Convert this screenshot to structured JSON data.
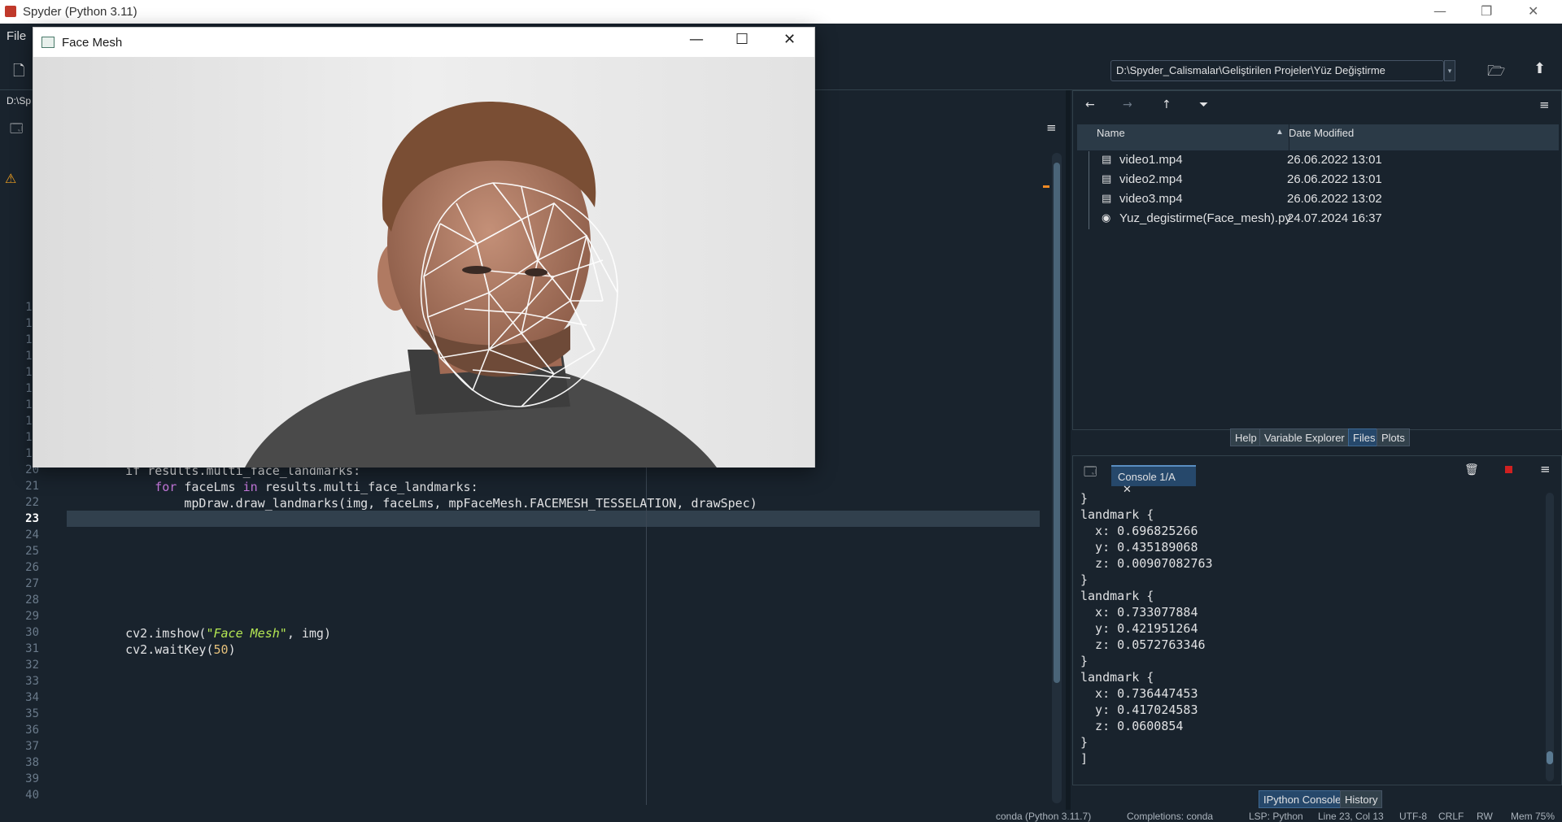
{
  "app": {
    "title": "Spyder (Python 3.11)",
    "window_controls": {
      "minimize": "—",
      "restore": "❐",
      "close": "✕"
    }
  },
  "menubar": {
    "items": [
      "File"
    ]
  },
  "toolbar": {
    "path": "D:\\Spyder_Calismalar\\Geliştirilen Projeler\\Yüz Değiştirme",
    "path_dropdown": "▾"
  },
  "editor": {
    "path_fragment": "D:\\Sp",
    "lines_visible": [
      "10",
      "11",
      "12",
      "13",
      "14",
      "15",
      "16",
      "17",
      "18",
      "19",
      "20",
      "21",
      "22",
      "23",
      "24",
      "25",
      "26",
      "27",
      "28",
      "29",
      "30",
      "31",
      "32",
      "33",
      "34",
      "35",
      "36",
      "37",
      "38",
      "39",
      "40"
    ],
    "current_line": "23",
    "code": {
      "l20": "    if results.multi_face_landmarks:",
      "l21_kw": "for",
      "l21_a": "        ",
      "l21_b": " faceLms ",
      "l21_kw2": "in",
      "l21_c": " results.multi_face_landmarks:",
      "l22": "            mpDraw.draw_landmarks(img, faceLms, mpFaceMesh.FACEMESH_TESSELATION, drawSpec)",
      "l30_a": "    cv2.imshow(",
      "l30_str": "\"Face Mesh\"",
      "l30_b": ", img)",
      "l31_a": "    cv2.waitKey(",
      "l31_num": "50",
      "l31_b": ")"
    }
  },
  "files": {
    "columns": {
      "name": "Name",
      "date": "Date Modified"
    },
    "rows": [
      {
        "name": "video1.mp4",
        "date": "26.06.2022 13:01",
        "icon": "file-icon"
      },
      {
        "name": "video2.mp4",
        "date": "26.06.2022 13:01",
        "icon": "file-icon"
      },
      {
        "name": "video3.mp4",
        "date": "26.06.2022 13:02",
        "icon": "file-icon"
      },
      {
        "name": "Yuz_degistirme(Face_mesh).py",
        "date": "24.07.2024 16:37",
        "icon": "python-icon"
      }
    ],
    "tabs": [
      "Help",
      "Variable Explorer",
      "Files",
      "Plots"
    ],
    "active_tab": "Files"
  },
  "console": {
    "tab_label": "Console 1/A",
    "output": "}\nlandmark {\n  x: 0.696825266\n  y: 0.435189068\n  z: 0.00907082763\n}\nlandmark {\n  x: 0.733077884\n  y: 0.421951264\n  z: 0.0572763346\n}\nlandmark {\n  x: 0.736447453\n  y: 0.417024583\n  z: 0.0600854\n}\n]",
    "tabs": [
      "IPython Console",
      "History"
    ],
    "active_tab": "IPython Console"
  },
  "statusbar": {
    "env": "conda (Python 3.11.7)",
    "completions": "Completions: conda",
    "lsp": "LSP: Python",
    "position": "Line 23, Col 13",
    "encoding": "UTF-8",
    "eol": "CRLF",
    "rw": "RW",
    "mem": "Mem 75%"
  },
  "facemesh_window": {
    "title": "Face Mesh",
    "controls": {
      "minimize": "—",
      "maximize": "☐",
      "close": "✕"
    }
  },
  "colors": {
    "background": "#19232d",
    "accent": "#26486b",
    "keyword": "#c678dd",
    "string": "#b5e853"
  }
}
